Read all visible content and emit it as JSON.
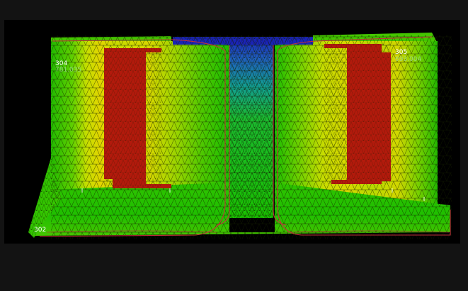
{
  "labels": [
    {
      "id": "304",
      "number": "304",
      "elevation": "781.035"
    },
    {
      "id": "305",
      "number": "305",
      "elevation": "693.004"
    },
    {
      "id": "302",
      "number": "302",
      "elevation": ""
    }
  ],
  "colors": {
    "background": "#131313",
    "viewport": "#000000",
    "low": "#1a23b8",
    "mid": "#d6d800",
    "high": "#19c200",
    "peak": "#b21a0c",
    "mesh": "#1a1a00",
    "contour": "#c0303a"
  }
}
